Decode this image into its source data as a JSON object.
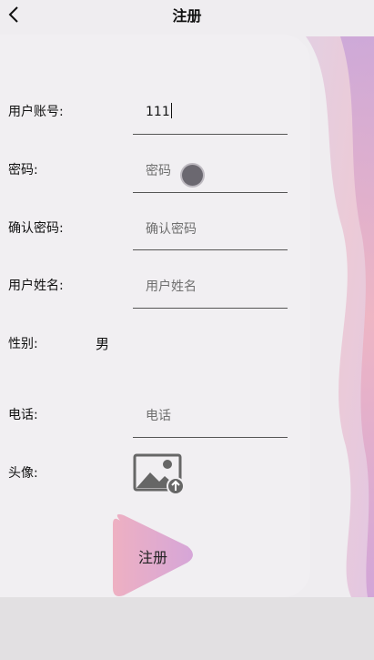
{
  "nav": {
    "title": "注册",
    "back_icon": "back-arrow-icon"
  },
  "form": {
    "account": {
      "label": "用户账号:",
      "value": "111"
    },
    "password": {
      "label": "密码:",
      "placeholder": "密码"
    },
    "confirm_password": {
      "label": "确认密码:",
      "placeholder": "确认密码"
    },
    "real_name": {
      "label": "用户姓名:",
      "placeholder": "用户姓名"
    },
    "gender": {
      "label": "性别:",
      "value": "男"
    },
    "phone": {
      "label": "电话:",
      "placeholder": "电话"
    },
    "avatar": {
      "label": "头像:",
      "icon": "image-upload-icon"
    },
    "submit_label": "注册"
  },
  "colors": {
    "accent_pink": "#eeb0c2",
    "accent_purple": "#d6a6d8",
    "background": "#efedf0"
  }
}
